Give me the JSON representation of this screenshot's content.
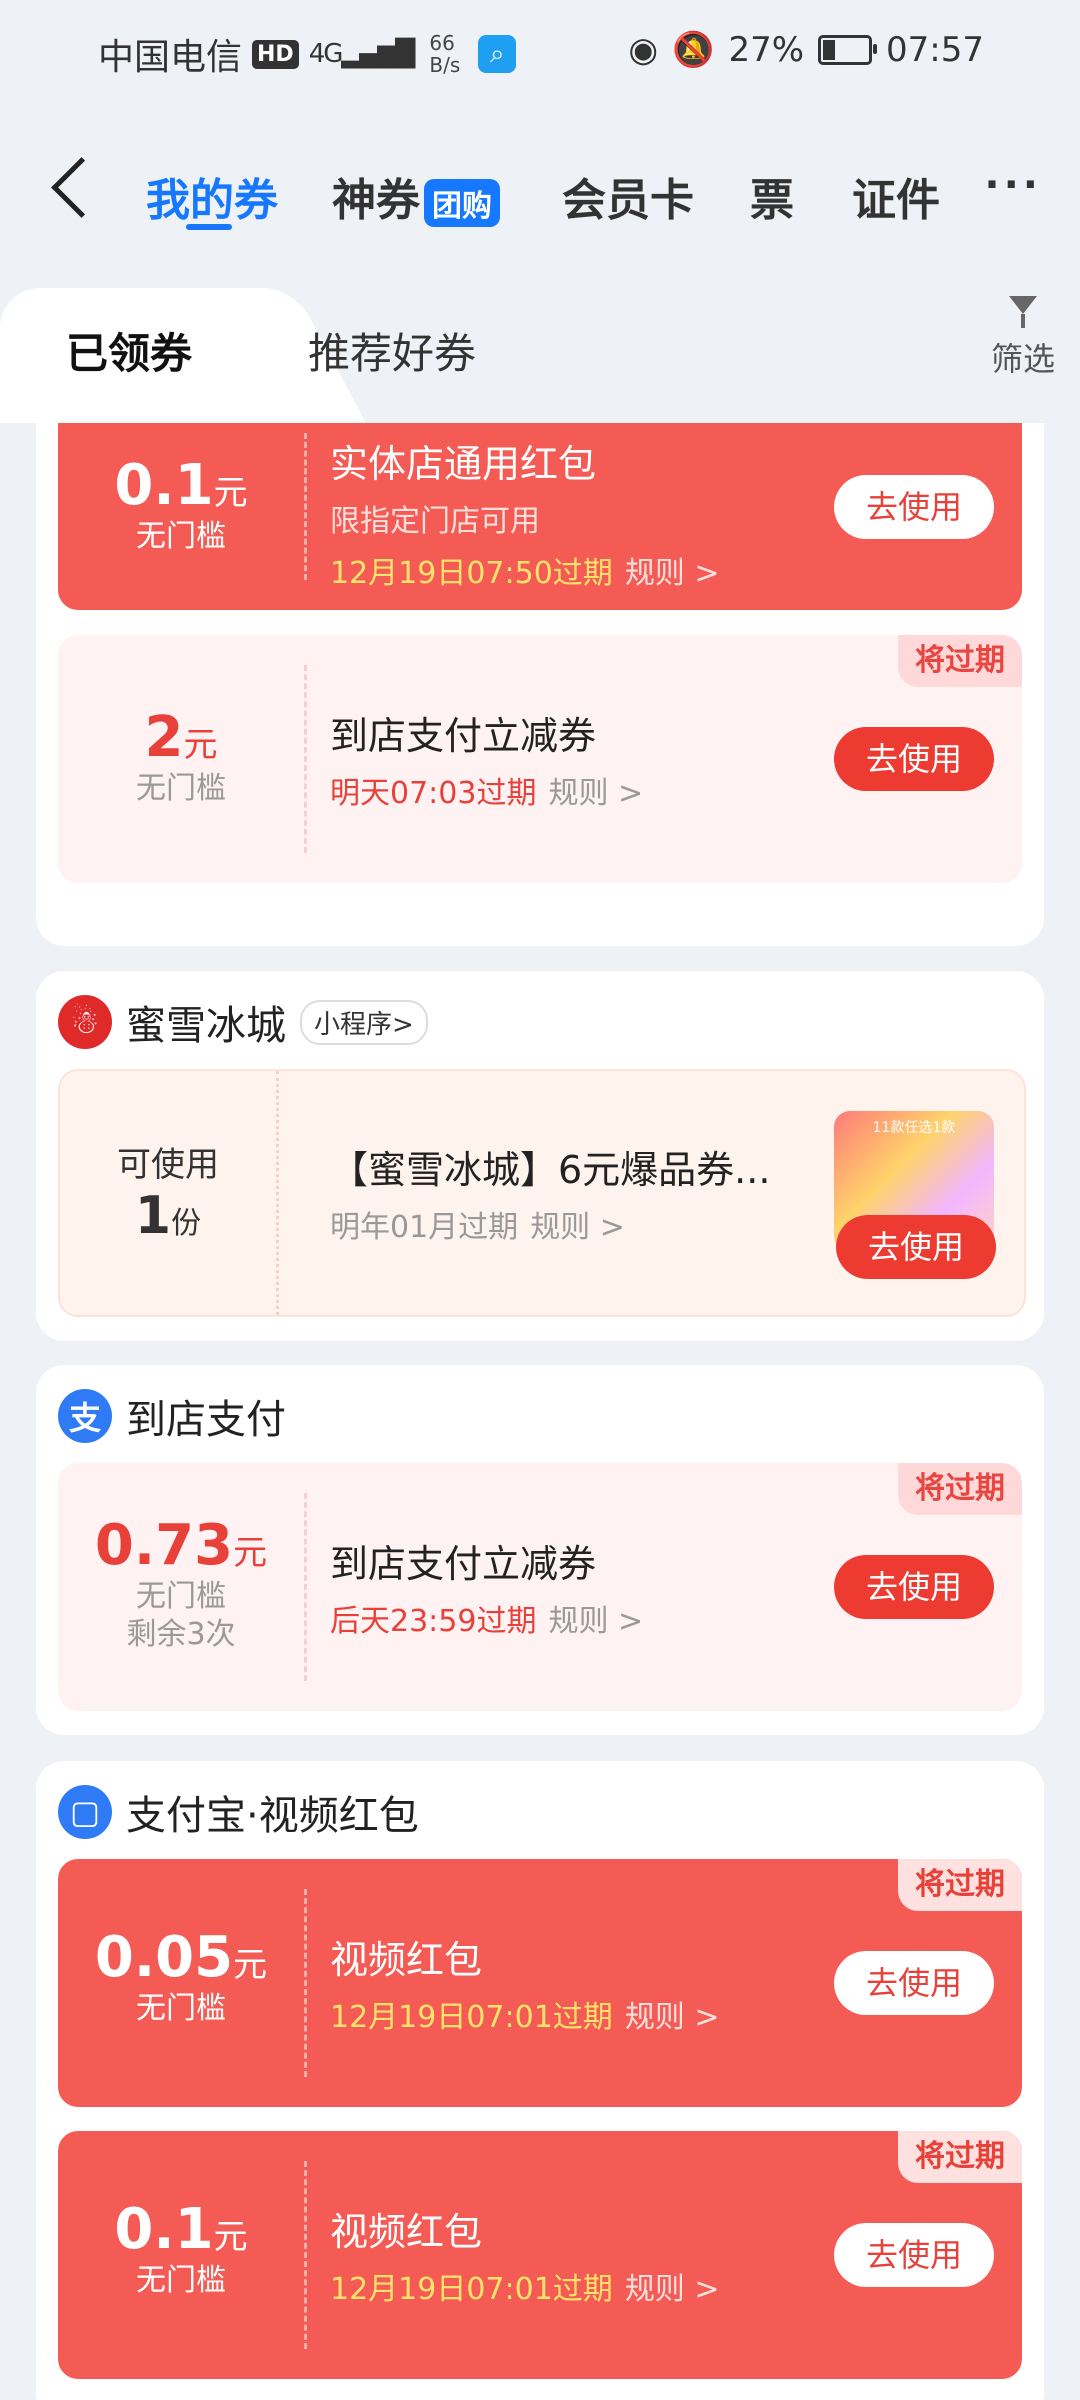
{
  "status": {
    "carrier": "中国电信",
    "hd": "HD",
    "net": "4G",
    "speed_value": "66",
    "speed_unit": "B/s",
    "battery": "27%",
    "time": "07:57"
  },
  "nav": {
    "tabs": [
      {
        "label": "我的券"
      },
      {
        "label": "神券"
      },
      {
        "label": "会员卡"
      },
      {
        "label": "票"
      },
      {
        "label": "证件"
      }
    ],
    "tuangou_badge": "团购",
    "more": "···"
  },
  "subtabs": {
    "received": "已领券",
    "recommended": "推荐好券",
    "filter": "筛选"
  },
  "groups": [
    {
      "coupons": [
        {
          "amount": "0.1",
          "unit": "元",
          "cond": "无门槛",
          "title": "实体店通用红包",
          "sub": "限指定门店可用",
          "expire": "12月19日07:50过期",
          "rule": "规则 >",
          "button": "去使用"
        },
        {
          "amount": "2",
          "unit": "元",
          "cond": "无门槛",
          "title": "到店支付立减券",
          "expire": "明天07:03过期",
          "rule": "规则 >",
          "button": "去使用",
          "tag": "将过期"
        }
      ]
    },
    {
      "name": "蜜雪冰城",
      "badge": "小程序>",
      "coupon": {
        "avail_label": "可使用",
        "count": "1",
        "count_unit": "份",
        "title": "【蜜雪冰城】6元爆品券...",
        "expire": "明年01月过期",
        "rule": "规则 >",
        "button": "去使用",
        "thumb_text": "11款任选1款"
      }
    },
    {
      "name": "到店支付",
      "coupon": {
        "amount": "0.73",
        "unit": "元",
        "cond": "无门槛",
        "remain": "剩余3次",
        "title": "到店支付立减券",
        "expire": "后天23:59过期",
        "rule": "规则 >",
        "button": "去使用",
        "tag": "将过期"
      }
    },
    {
      "name": "支付宝·视频红包",
      "coupons": [
        {
          "amount": "0.05",
          "unit": "元",
          "cond": "无门槛",
          "title": "视频红包",
          "expire": "12月19日07:01过期",
          "rule": "规则 >",
          "button": "去使用",
          "tag": "将过期"
        },
        {
          "amount": "0.1",
          "unit": "元",
          "cond": "无门槛",
          "title": "视频红包",
          "expire": "12月19日07:01过期",
          "rule": "规则 >",
          "button": "去使用",
          "tag": "将过期"
        }
      ]
    }
  ],
  "colors": {
    "primary": "#1677ff",
    "coupon_red": "#f45b54",
    "coupon_pink": "#fff2f2",
    "expire_yellow": "#ffe36b",
    "expire_red": "#e8413a"
  }
}
